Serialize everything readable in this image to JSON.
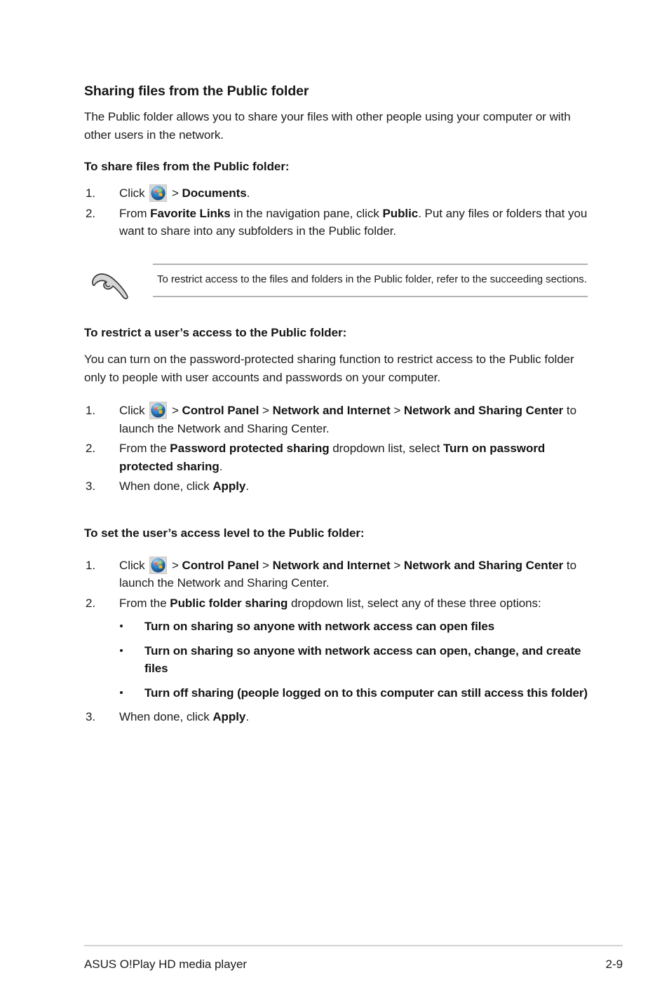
{
  "document": {
    "section_title": "Sharing files from the Public folder",
    "intro_paragraph": "The Public folder allows you to share your files with other people using your computer or with other users in the network."
  },
  "sections": [
    {
      "heading": "To share files from the Public folder:",
      "steps": [
        {
          "number": "1.",
          "parts": [
            {
              "text": "Click ",
              "bold": false
            },
            {
              "icon": "windows-start-orb-icon"
            },
            {
              "text": " > ",
              "bold": false
            },
            {
              "text": "Documents",
              "bold": true
            },
            {
              "text": ".",
              "bold": false
            }
          ]
        },
        {
          "number": "2.",
          "parts": [
            {
              "text": "From ",
              "bold": false
            },
            {
              "text": "Favorite Links",
              "bold": true
            },
            {
              "text": " in the navigation pane, click ",
              "bold": false
            },
            {
              "text": "Public",
              "bold": true
            },
            {
              "text": ". Put any files or folders that you want to share into any subfolders in the Public folder.",
              "bold": false
            }
          ]
        }
      ]
    },
    {
      "heading": "To restrict a user’s access to the Public folder:",
      "paragraph": "You can turn on the password-protected sharing function to restrict access to the Public folder only to people with user accounts and passwords on your computer.",
      "steps": [
        {
          "number": "1.",
          "parts": [
            {
              "text": "Click ",
              "bold": false
            },
            {
              "icon": "windows-start-orb-icon"
            },
            {
              "text": " > ",
              "bold": false
            },
            {
              "text": "Control Panel",
              "bold": true
            },
            {
              "text": " > ",
              "bold": false
            },
            {
              "text": "Network and Internet",
              "bold": true
            },
            {
              "text": " > ",
              "bold": false
            },
            {
              "text": "Network and Sharing Center",
              "bold": true
            },
            {
              "text": " to launch the Network and Sharing Center.",
              "bold": false
            }
          ]
        },
        {
          "number": "2.",
          "parts": [
            {
              "text": "From the ",
              "bold": false
            },
            {
              "text": "Password protected sharing",
              "bold": true
            },
            {
              "text": " dropdown list, select ",
              "bold": false
            },
            {
              "text": "Turn on password protected sharing",
              "bold": true
            },
            {
              "text": ".",
              "bold": false
            }
          ]
        },
        {
          "number": "3.",
          "parts": [
            {
              "text": "When done, click ",
              "bold": false
            },
            {
              "text": "Apply",
              "bold": true
            },
            {
              "text": ".",
              "bold": false
            }
          ]
        }
      ]
    },
    {
      "heading": "To set the user’s access level to the Public folder:",
      "steps": [
        {
          "number": "1.",
          "parts": [
            {
              "text": "Click ",
              "bold": false
            },
            {
              "icon": "windows-start-orb-icon"
            },
            {
              "text": " > ",
              "bold": false
            },
            {
              "text": "Control Panel",
              "bold": true
            },
            {
              "text": " > ",
              "bold": false
            },
            {
              "text": "Network and Internet",
              "bold": true
            },
            {
              "text": " > ",
              "bold": false
            },
            {
              "text": "Network and Sharing Center",
              "bold": true
            },
            {
              "text": " to launch the Network and Sharing Center.",
              "bold": false
            }
          ]
        },
        {
          "number": "2.",
          "parts": [
            {
              "text": "From the ",
              "bold": false
            },
            {
              "text": "Public folder sharing",
              "bold": true
            },
            {
              "text": " dropdown list, select any of these three options:",
              "bold": false
            }
          ]
        },
        {
          "number": "3.",
          "parts": [
            {
              "text": "When done, click ",
              "bold": false
            },
            {
              "text": "Apply",
              "bold": true
            },
            {
              "text": ".",
              "bold": false
            }
          ]
        }
      ],
      "bullet_options": [
        "Turn on sharing so anyone with network access can open files",
        "Turn on sharing so anyone with network access can open, change, and create files",
        "Turn off sharing (people logged on to this computer can still access this folder)"
      ]
    }
  ],
  "note": {
    "icon": "pointing-hand-icon",
    "text": "To restrict access to the files and folders in the Public folder, refer to the succeeding sections."
  },
  "footer": {
    "left_text": "ASUS O!Play HD media player",
    "page_number": "2-9"
  },
  "colors": {
    "text": "#1c1c1c",
    "rule": "#b2b2b2",
    "footer_rule": "#d2d2d2",
    "orb_red": "#e8503a",
    "orb_green": "#7dc242",
    "orb_blue": "#2e8ad4",
    "orb_yellow": "#f4b41a",
    "note_icon_fill": "#d4d4d4"
  }
}
